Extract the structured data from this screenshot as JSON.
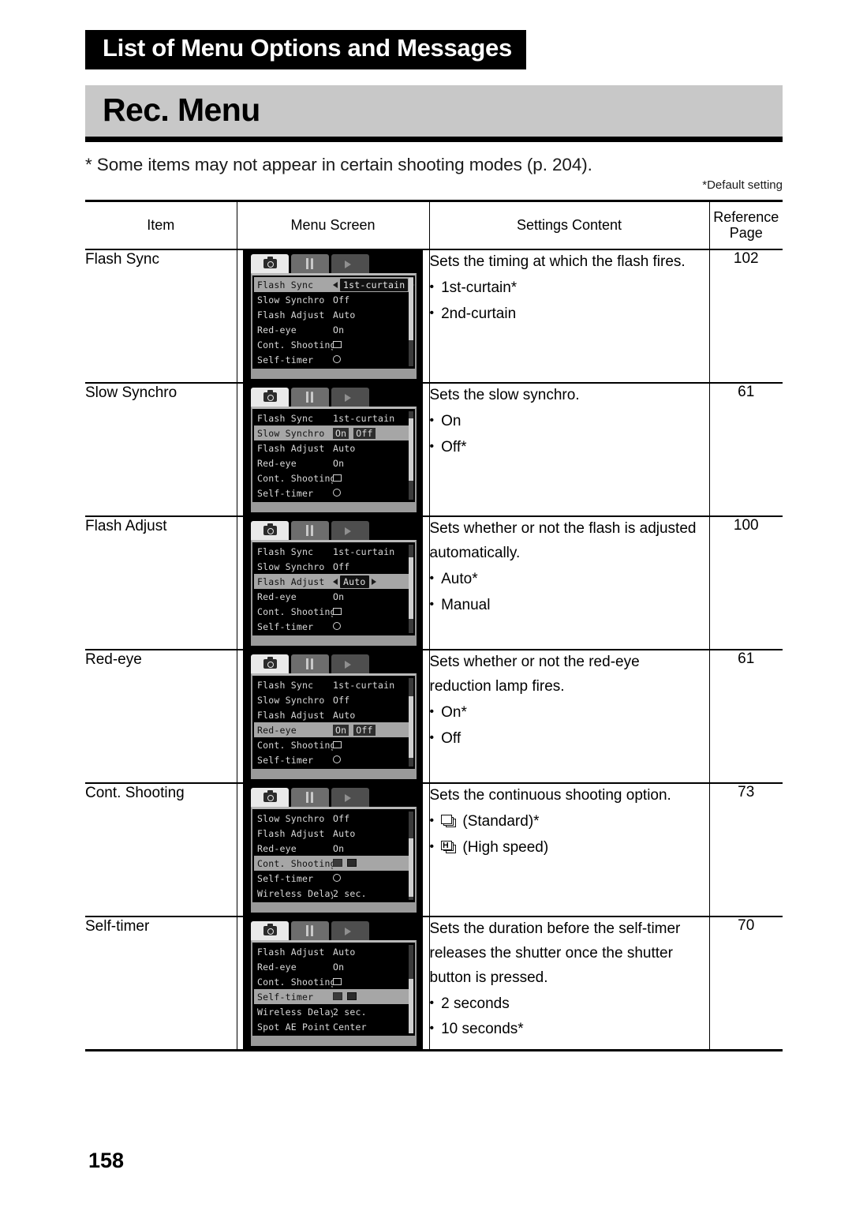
{
  "header": {
    "chapter_title": "List of Menu Options and Messages",
    "section_title": "Rec. Menu",
    "intro_note": "* Some items may not appear in certain shooting modes (p. 204).",
    "default_note": "*Default setting"
  },
  "table": {
    "columns": [
      "Item",
      "Menu Screen",
      "Settings Content",
      "Reference Page"
    ],
    "column_header_item": "Item",
    "column_header_screen": "Menu Screen",
    "column_header_settings": "Settings Content",
    "column_header_ref_line1": "Reference",
    "column_header_ref_line2": "Page",
    "rows": [
      {
        "item": "Flash Sync",
        "description": "Sets the timing at which the flash fires.",
        "options": [
          "1st-curtain*",
          "2nd-curtain"
        ],
        "reference_page": "102",
        "lcd": {
          "tabs": [
            "camera-icon",
            "tools-icon",
            "playback-icon"
          ],
          "selected_index": 0,
          "selection_style": "arrows",
          "scroll_top_pct": 0,
          "scroll_height_pct": 70,
          "rows": [
            {
              "label": "Flash Sync",
              "value": "1st-curtain"
            },
            {
              "label": "Slow Synchro",
              "value": "Off"
            },
            {
              "label": "Flash Adjust",
              "value": "Auto"
            },
            {
              "label": "Red-eye",
              "value": "On"
            },
            {
              "label": "Cont. Shooting",
              "value": "frames-icon"
            },
            {
              "label": "Self-timer",
              "value": "timer-icon"
            }
          ]
        }
      },
      {
        "item": "Slow Synchro",
        "description": "Sets the slow synchro.",
        "options": [
          "On",
          "Off*"
        ],
        "reference_page": "61",
        "lcd": {
          "tabs": [
            "camera-icon",
            "tools-icon",
            "playback-icon"
          ],
          "selected_index": 1,
          "selection_style": "choice",
          "choice_options": [
            "On",
            "Off"
          ],
          "choice_selected": "Off",
          "scroll_top_pct": 8,
          "scroll_height_pct": 70,
          "rows": [
            {
              "label": "Flash Sync",
              "value": "1st-curtain"
            },
            {
              "label": "Slow Synchro",
              "value": "On Off"
            },
            {
              "label": "Flash Adjust",
              "value": "Auto"
            },
            {
              "label": "Red-eye",
              "value": "On"
            },
            {
              "label": "Cont. Shooting",
              "value": "frames-icon"
            },
            {
              "label": "Self-timer",
              "value": "timer-icon"
            }
          ]
        }
      },
      {
        "item": "Flash Adjust",
        "description": "Sets whether or not the flash is adjusted automatically.",
        "description_lines": [
          "Sets whether or not the flash is adjusted",
          "automatically."
        ],
        "options": [
          "Auto*",
          "Manual"
        ],
        "reference_page": "100",
        "lcd": {
          "tabs": [
            "camera-icon",
            "tools-icon",
            "playback-icon"
          ],
          "selected_index": 2,
          "selection_style": "arrows",
          "scroll_top_pct": 14,
          "scroll_height_pct": 70,
          "rows": [
            {
              "label": "Flash Sync",
              "value": "1st-curtain"
            },
            {
              "label": "Slow Synchro",
              "value": "Off"
            },
            {
              "label": "Flash Adjust",
              "value": "Auto"
            },
            {
              "label": "Red-eye",
              "value": "On"
            },
            {
              "label": "Cont. Shooting",
              "value": "frames-icon"
            },
            {
              "label": "Self-timer",
              "value": "timer-icon"
            }
          ]
        }
      },
      {
        "item": "Red-eye",
        "description": "Sets whether or not the red-eye reduction lamp fires.",
        "description_lines": [
          "Sets whether or not the red-eye",
          "reduction lamp fires."
        ],
        "options": [
          "On*",
          "Off"
        ],
        "reference_page": "61",
        "lcd": {
          "tabs": [
            "camera-icon",
            "tools-icon",
            "playback-icon"
          ],
          "selected_index": 3,
          "selection_style": "choice",
          "choice_options": [
            "On",
            "Off"
          ],
          "choice_selected": "On",
          "scroll_top_pct": 20,
          "scroll_height_pct": 70,
          "rows": [
            {
              "label": "Flash Sync",
              "value": "1st-curtain"
            },
            {
              "label": "Slow Synchro",
              "value": "Off"
            },
            {
              "label": "Flash Adjust",
              "value": "Auto"
            },
            {
              "label": "Red-eye",
              "value": "On Off"
            },
            {
              "label": "Cont. Shooting",
              "value": "frames-icon"
            },
            {
              "label": "Self-timer",
              "value": "timer-icon"
            }
          ]
        }
      },
      {
        "item": "Cont. Shooting",
        "description": "Sets the continuous shooting option.",
        "options": [
          "(Standard)*",
          "(High speed)"
        ],
        "option_icons": [
          "frames-standard-icon",
          "frames-highspeed-icon"
        ],
        "reference_page": "73",
        "lcd": {
          "tabs": [
            "camera-icon",
            "tools-icon",
            "playback-icon"
          ],
          "selected_index": 3,
          "selection_style": "choice-icons",
          "scroll_top_pct": 30,
          "scroll_height_pct": 66,
          "rows": [
            {
              "label": "Slow Synchro",
              "value": "Off"
            },
            {
              "label": "Flash Adjust",
              "value": "Auto"
            },
            {
              "label": "Red-eye",
              "value": "On"
            },
            {
              "label": "Cont. Shooting",
              "value": "icons"
            },
            {
              "label": "Self-timer",
              "value": "timer-icon"
            },
            {
              "label": "Wireless Delay",
              "value": "2 sec."
            }
          ]
        }
      },
      {
        "item": "Self-timer",
        "description": "Sets the duration before the self-timer releases the shutter once the shutter button is pressed.",
        "description_lines": [
          "Sets the duration before the self-timer",
          "releases the shutter once the shutter",
          "button is pressed."
        ],
        "options": [
          "2 seconds",
          "10 seconds*"
        ],
        "reference_page": "70",
        "lcd": {
          "tabs": [
            "camera-icon",
            "tools-icon",
            "playback-icon"
          ],
          "selected_index": 3,
          "selection_style": "choice-icons",
          "scroll_top_pct": 38,
          "scroll_height_pct": 62,
          "rows": [
            {
              "label": "Flash Adjust",
              "value": "Auto"
            },
            {
              "label": "Red-eye",
              "value": "On"
            },
            {
              "label": "Cont. Shooting",
              "value": "frames-icon"
            },
            {
              "label": "Self-timer",
              "value": "icons"
            },
            {
              "label": "Wireless Delay",
              "value": "2 sec."
            },
            {
              "label": "Spot AE Point",
              "value": "Center"
            }
          ]
        }
      }
    ]
  },
  "footer": {
    "page_number": "158"
  },
  "colors": {
    "banner_bg": "#000000",
    "section_bg": "#c8c8c8",
    "lcd_bg": "#000000",
    "lcd_highlight": "#a6a6a6",
    "text": "#000000"
  }
}
